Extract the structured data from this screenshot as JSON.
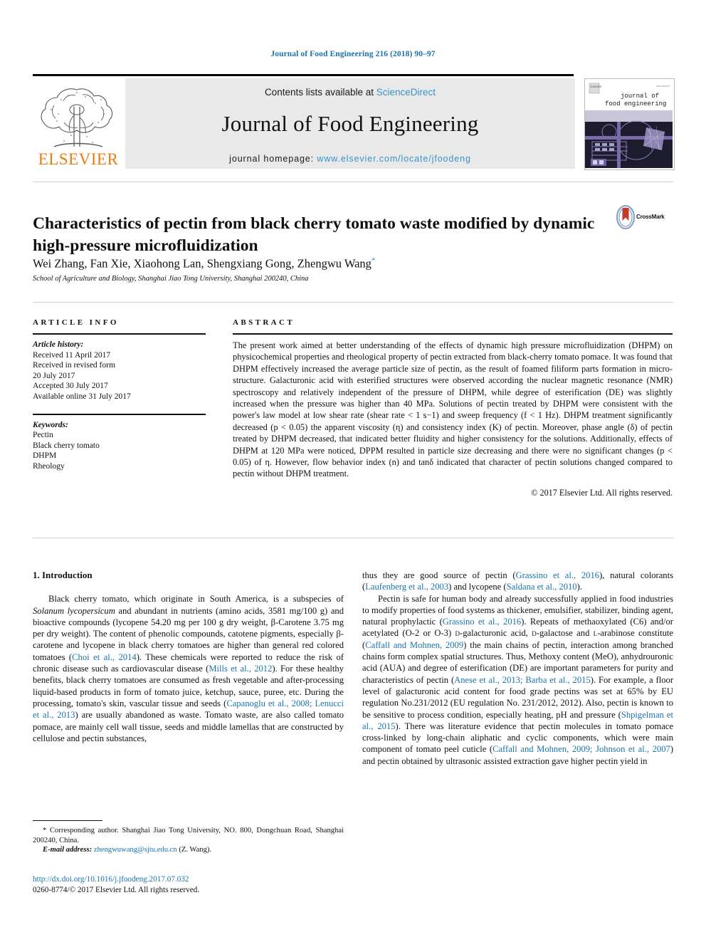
{
  "running_head": "Journal of Food Engineering 216 (2018) 90–97",
  "masthead": {
    "contents_prefix": "Contents lists available at ",
    "sciencedirect": "ScienceDirect",
    "journal_title": "Journal of Food Engineering",
    "homepage_prefix": "journal homepage: ",
    "homepage_url": "www.elsevier.com/locate/jfoodeng",
    "publisher_wordmark": "ELSEVIER",
    "cover_title_line1": "journal of",
    "cover_title_line2": "food engineering",
    "colors": {
      "link_blue": "#3a93c9",
      "elsevier_orange": "#eb7b0f",
      "banner_gray": "#e9e9e9",
      "running_head_blue": "#1a74ab",
      "cover_purple": "#7b6aa8"
    }
  },
  "article": {
    "title": "Characteristics of pectin from black cherry tomato waste modified by dynamic high-pressure microfluidization",
    "authors": "Wei Zhang, Fan Xie, Xiaohong Lan, Shengxiang Gong, Zhengwu Wang",
    "corresponding_marker": "*",
    "affiliation": "School of Agriculture and Biology, Shanghai Jiao Tong University, Shanghai 200240, China",
    "crossmark_label": "CrossMark"
  },
  "article_info": {
    "heading": "ARTICLE INFO",
    "history_label": "Article history:",
    "history": [
      "Received 11 April 2017",
      "Received in revised form",
      "20 July 2017",
      "Accepted 30 July 2017",
      "Available online 31 July 2017"
    ],
    "keywords_label": "Keywords:",
    "keywords": [
      "Pectin",
      "Black cherry tomato",
      "DHPM",
      "Rheology"
    ]
  },
  "abstract": {
    "heading": "ABSTRACT",
    "text": "The present work aimed at better understanding of the effects of dynamic high pressure microfluidization (DHPM) on physicochemical properties and rheological property of pectin extracted from black-cherry tomato pomace. It was found that DHPM effectively increased the average particle size of pectin, as the result of foamed filiform parts formation in micro-structure. Galacturonic acid with esterified structures were observed according the nuclear magnetic resonance (NMR) spectroscopy and relatively independent of the pressure of DHPM, while degree of esterification (DE) was slightly increased when the pressure was higher than 40 MPa. Solutions of pectin treated by DHPM were consistent with the power's law model at low shear rate (shear rate < 1 s−1) and sweep frequency (f < 1 Hz). DHPM treatment significantly decreased (p < 0.05) the apparent viscosity (η) and consistency index (K) of pectin. Moreover, phase angle (δ) of pectin treated by DHPM decreased, that indicated better fluidity and higher consistency for the solutions. Additionally, effects of DHPM at 120 MPa were noticed, DPPM resulted in particle size decreasing and there were no significant changes (p < 0.05) of η. However, flow behavior index (n) and tanδ indicated that character of pectin solutions changed compared to pectin without DHPM treatment.",
    "copyright": "© 2017 Elsevier Ltd. All rights reserved."
  },
  "introduction": {
    "heading": "1. Introduction",
    "left_paragraph_1": "Black cherry tomato, which originate in South America, is a subspecies of Solanum lycopersicum and abundant in nutrients (amino acids, 3581 mg/100 g) and bioactive compounds (lycopene 54.20 mg per 100 g dry weight, β-Carotene 3.75 mg per dry weight). The content of phenolic compounds, catotene pigments, especially β-carotene and lycopene in black cherry tomatoes are higher than general red colored tomatoes (Choi et al., 2014). These chemicals were reported to reduce the risk of chronic disease such as cardiovascular disease (Mills et al., 2012). For these healthy benefits, black cherry tomatoes are consumed as fresh vegetable and after-processing liquid-based products in form of tomato juice, ketchup, sauce, puree, etc. During the processing, tomato's skin, vascular tissue and seeds (Capanoglu et al., 2008; Lenucci et al., 2013) are usually abandoned as waste. Tomato waste, are also called tomato pomace, are mainly cell wall tissue, seeds and middle lamellas that are constructed by cellulose and pectin substances,",
    "right_paragraph_1_cont": "thus they are good source of pectin (Grassino et al., 2016), natural colorants (Laufenberg et al., 2003) and lycopene (Saldana et al., 2010).",
    "right_paragraph_2": "Pectin is safe for human body and already successfully applied in food industries to modify properties of food systems as thickener, emulsifier, stabilizer, binding agent, natural prophylactic (Grassino et al., 2016). Repeats of methaoxylated (C6) and/or acetylated (O-2 or O-3) D-galacturonic acid, D-galactose and L-arabinose constitute (Caffall and Mohnen, 2009) the main chains of pectin, interaction among branched chains form complex spatial structures. Thus, Methoxy content (MeO), anhydrouronic acid (AUA) and degree of esterification (DE) are important parameters for purity and characteristics of pectin (Anese et al., 2013; Barba et al., 2015). For example, a floor level of galacturonic acid content for food grade pectins was set at 65% by EU regulation No.231/2012 (EU regulation No. 231/2012, 2012). Also, pectin is known to be sensitive to process condition, especially heating, pH and pressure (Shpigelman et al., 2015). There was literature evidence that pectin molecules in tomato pomace cross-linked by long-chain aliphatic and cyclic components, which were main component of tomato peel cuticle (Caffall and Mohnen, 2009; Johnson et al., 2007) and pectin obtained by ultrasonic assisted extraction gave higher pectin yield in",
    "references_inline": [
      "Choi et al., 2014",
      "Mills et al., 2012",
      "Capanoglu et al., 2008; Lenucci et al., 2013",
      "Grassino et al., 2016",
      "Laufenberg et al., 2003",
      "Saldana et al., 2010",
      "Caffall and Mohnen, 2009",
      "Anese et al., 2013; Barba et al., 2015",
      "Shpigelman et al., 2015",
      "Caffall and Mohnen, 2009; Johnson et al., 2007"
    ]
  },
  "footer": {
    "corresponding_marker": "*",
    "corresponding_text": "Corresponding author. Shanghai Jiao Tong University, NO. 800, Dongchuan Road, Shanghai 200240, China.",
    "email_label": "E-mail address:",
    "email": "zhengwuwang@sjtu.edu.cn",
    "email_suffix": "(Z. Wang).",
    "doi": "http://dx.doi.org/10.1016/j.jfoodeng.2017.07.032",
    "issn_line": "0260-8774/© 2017 Elsevier Ltd. All rights reserved."
  }
}
